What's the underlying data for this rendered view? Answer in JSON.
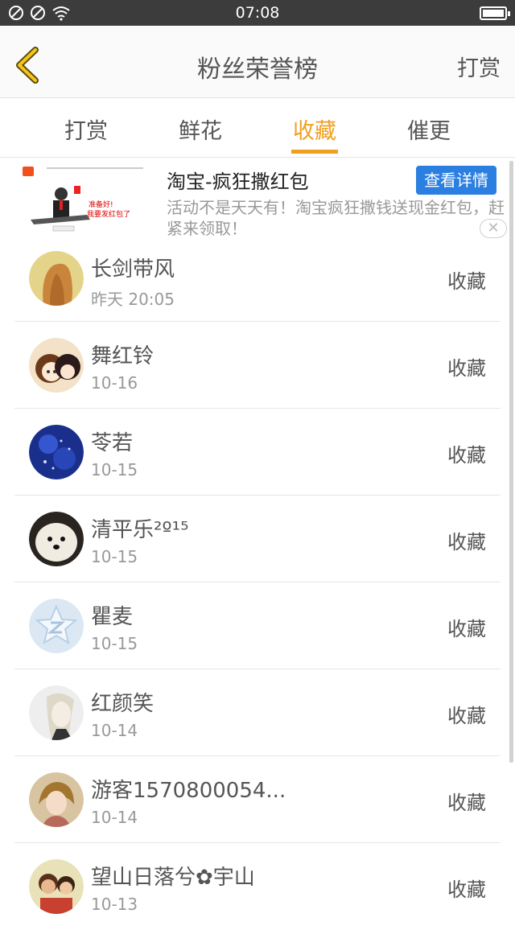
{
  "status_bar": {
    "time": "07:08"
  },
  "nav": {
    "title": "粉丝荣誉榜",
    "right_action": "打赏"
  },
  "tabs": [
    {
      "label": "打赏"
    },
    {
      "label": "鲜花"
    },
    {
      "label": "收藏"
    },
    {
      "label": "催更"
    }
  ],
  "active_tab": "收藏",
  "ad": {
    "title": "淘宝-疯狂撒红包",
    "button": "查看详情",
    "description": "活动不是天天有！淘宝疯狂撒钱送现金红包，赶紧来领取！",
    "image_caption": "准备好！我要发红包了"
  },
  "fans": [
    {
      "name": "长剑带风",
      "date": "昨天 20:05",
      "action": "收藏"
    },
    {
      "name": "舞红铃",
      "date": "10-16",
      "action": "收藏"
    },
    {
      "name": "苓若",
      "date": "10-15",
      "action": "收藏"
    },
    {
      "name": "清平乐²º¹⁵",
      "date": "10-15",
      "action": "收藏"
    },
    {
      "name": "瞿麦",
      "date": "10-15",
      "action": "收藏"
    },
    {
      "name": "红颜笑",
      "date": "10-14",
      "action": "收藏"
    },
    {
      "name": "游客1570800054...",
      "date": "10-14",
      "action": "收藏"
    },
    {
      "name": "望山日落兮✿宇山",
      "date": "10-13",
      "action": "收藏"
    }
  ],
  "colors": {
    "accent": "#f0a020",
    "ad_button": "#2a7fe0",
    "status_bar": "#3c3c3c"
  }
}
